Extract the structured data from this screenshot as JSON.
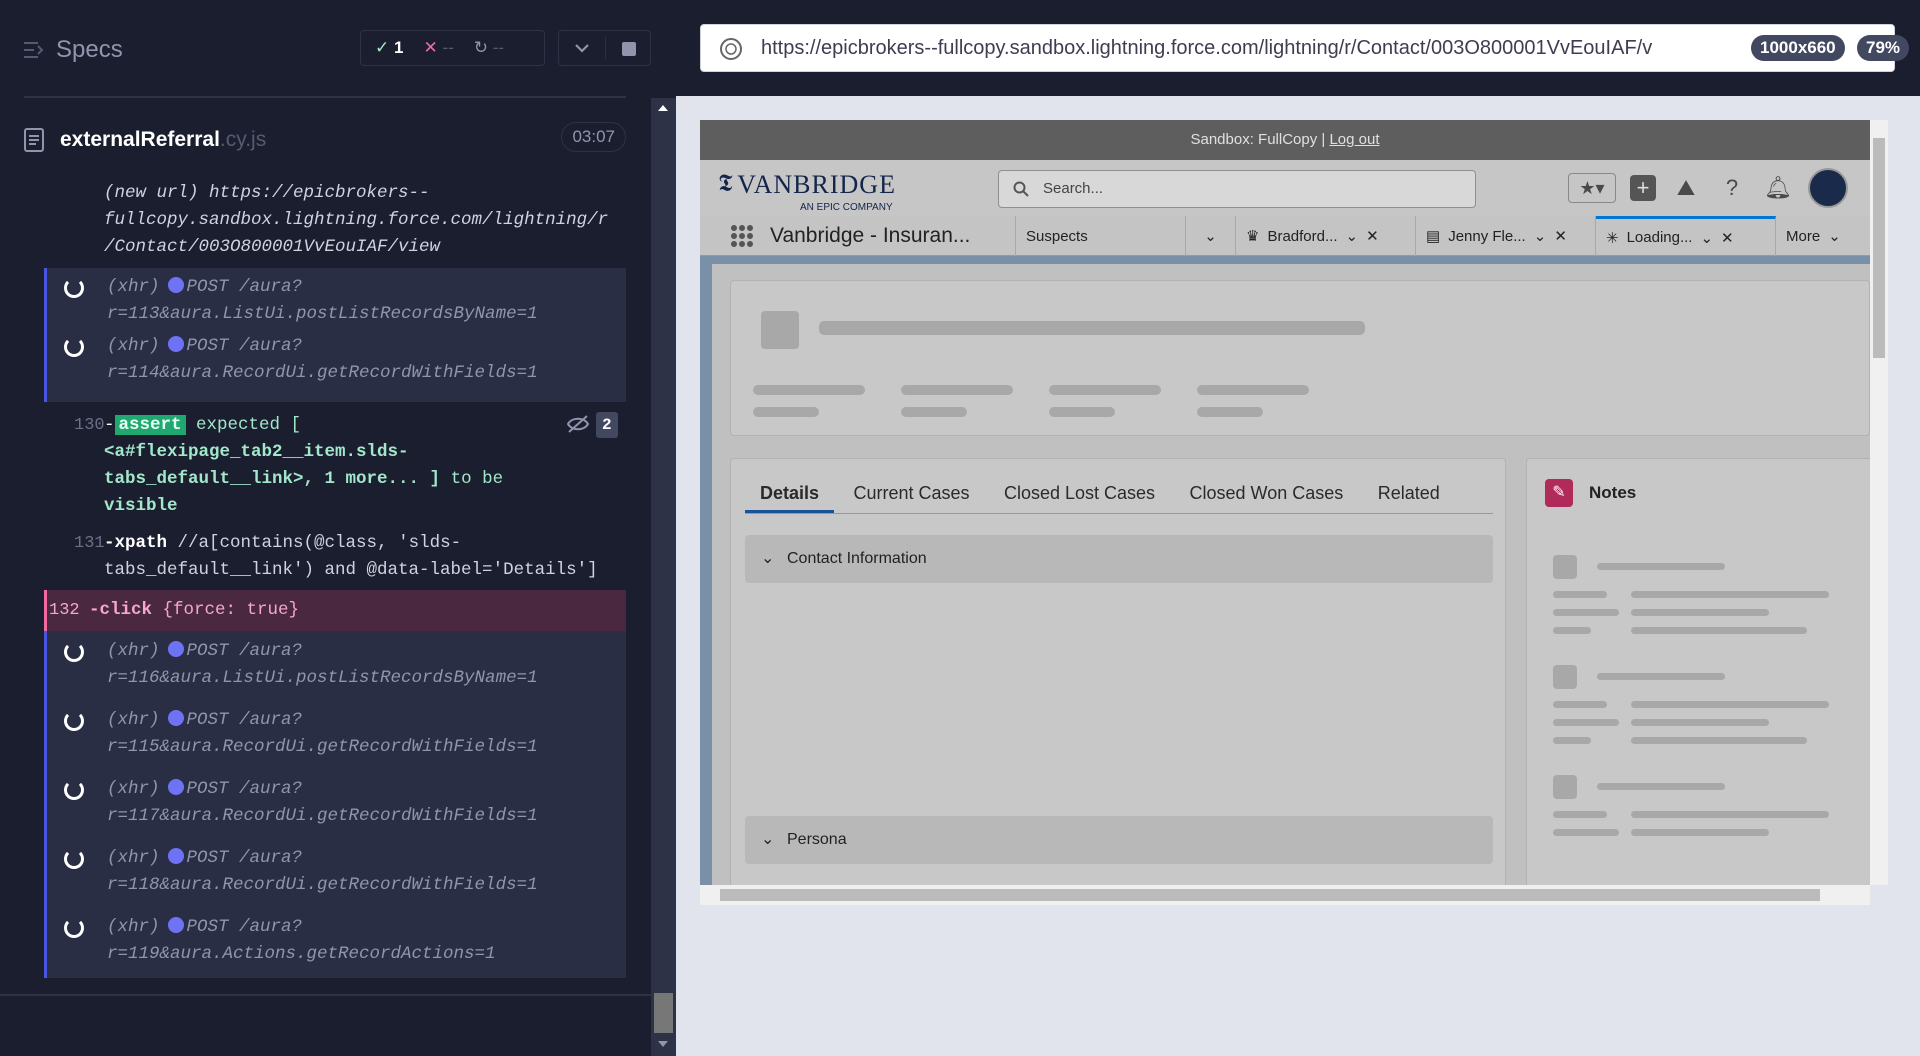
{
  "runner": {
    "specs_label": "Specs",
    "passed": "1",
    "failed": "--",
    "pending": "--",
    "spec_name": "externalReferral",
    "spec_ext": ".cy.js",
    "duration": "03:07"
  },
  "log": {
    "url_line1": "(new url)  https://epicbrokers--",
    "url_line2": "fullcopy.sandbox.lightning.force.com/lightning/r",
    "url_line3": "/Contact/003O800001VvEouIAF/view",
    "xhr1_a": "(xhr)",
    "xhr1_method": "POST /aura?",
    "xhr1_b": "r=113&aura.ListUi.postListRecordsByName=1",
    "xhr2_a": "(xhr)",
    "xhr2_method": "POST /aura?",
    "xhr2_b": "r=114&aura.RecordUi.getRecordWithFields=1",
    "assert_num": "130",
    "assert_tag": "assert",
    "assert_l1": "expected  [",
    "assert_l2": "<a#flexipage_tab2__item.slds-",
    "assert_l3a": "tabs_default__link>, 1 more... ]",
    "assert_l3b": " to be",
    "assert_l4": "visible",
    "assert_count": "2",
    "xpath_num": "131",
    "xpath_kw": "-xpath",
    "xpath_l1": "//a[contains(@class, 'slds-",
    "xpath_l2": "tabs_default__link') and @data-label='Details']",
    "click_num": "132",
    "click_kw": "-click",
    "click_arg": "{force: true}",
    "xhr3_method": "POST /aura?",
    "xhr3_b": "r=116&aura.ListUi.postListRecordsByName=1",
    "xhr4_method": "POST /aura?",
    "xhr4_b": "r=115&aura.RecordUi.getRecordWithFields=1",
    "xhr5_method": "POST /aura?",
    "xhr5_b": "r=117&aura.RecordUi.getRecordWithFields=1",
    "xhr6_method": "POST /aura?",
    "xhr6_b": "r=118&aura.RecordUi.getRecordWithFields=1",
    "xhr7_method": "POST /aura?",
    "xhr7_b": "r=119&aura.Actions.getRecordActions=1",
    "xhr_label": "(xhr)"
  },
  "browser": {
    "url": "https://epicbrokers--fullcopy.sandbox.lightning.force.com/lightning/r/Contact/003O800001VvEouIAF/v",
    "viewport": "1000x660",
    "zoom": "79%"
  },
  "sf": {
    "sandbox_text": "Sandbox: FullCopy |",
    "logout": "Log out",
    "logo_main": "VANBRIDGE",
    "logo_sub": "AN EPIC COMPANY",
    "search_placeholder": "Search...",
    "app_name": "Vanbridge - Insuran...",
    "tab_suspects": "Suspects",
    "tab_bradford": "Bradford...",
    "tab_jenny": "Jenny Fle...",
    "tab_loading": "Loading...",
    "tab_more": "More",
    "detail_tabs": [
      "Details",
      "Current Cases",
      "Closed Lost Cases",
      "Closed Won Cases",
      "Related"
    ],
    "section_contact": "Contact Information",
    "section_persona": "Persona",
    "notes_title": "Notes"
  },
  "colors": {
    "accent": "#4956e3",
    "pass": "#a3e7cb",
    "fail": "#f16aa0"
  }
}
